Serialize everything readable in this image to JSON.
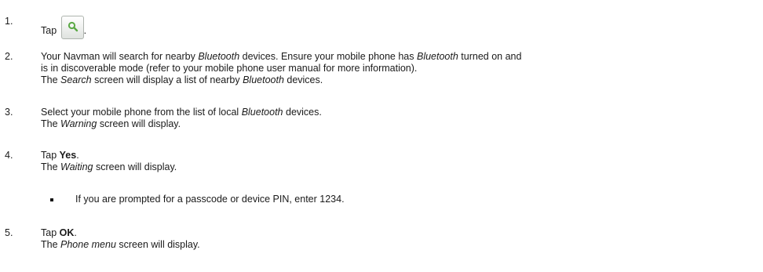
{
  "steps": [
    {
      "number": "1.",
      "text_a": "Tap",
      "text_b": ".",
      "icon": "search-icon",
      "icon_color": "#5aa844"
    },
    {
      "number": "2.",
      "l1_a": "Your Navman will search for nearby ",
      "l1_b": "Bluetooth",
      "l1_c": " devices. Ensure your mobile phone has ",
      "l1_d": "Bluetooth",
      "l1_e": " turned on and",
      "l2": "is in discoverable mode (refer to your mobile phone user manual for more information).",
      "l3_a": "The ",
      "l3_b": "Search",
      "l3_c": " screen will display a list of nearby ",
      "l3_d": "Bluetooth",
      "l3_e": " devices."
    },
    {
      "number": "3.",
      "l1_a": "Select your mobile phone from the list of local ",
      "l1_b": "Bluetooth",
      "l1_c": " devices.",
      "l2_a": "The ",
      "l2_b": "Warning",
      "l2_c": " screen will display."
    },
    {
      "number": "4.",
      "l1_a": "Tap ",
      "l1_b": "Yes",
      "l1_c": ".",
      "l2_a": "The ",
      "l2_b": "Waiting",
      "l2_c": " screen will display.",
      "bullet": "If you are prompted for a passcode or device PIN, enter 1234."
    },
    {
      "number": "5.",
      "l1_a": "Tap ",
      "l1_b": "OK",
      "l1_c": ".",
      "l2_a": "The ",
      "l2_b": "Phone menu",
      "l2_c": " screen will display."
    }
  ]
}
